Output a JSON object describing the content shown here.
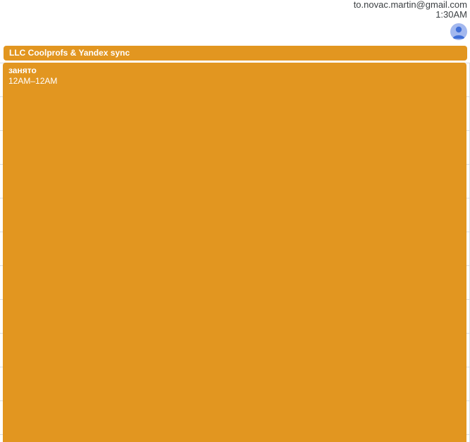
{
  "account": {
    "email": "to.novac.martin@gmail.com",
    "time": "1:30AM",
    "avatar_icon": "person-avatar-icon",
    "avatar_color": "#a3b8ee"
  },
  "allday_event": {
    "title": "LLC Coolprofs & Yandex sync",
    "color": "#e29620"
  },
  "timed_event": {
    "title": "занято",
    "time": "12AM–12AM",
    "color": "#e29620"
  }
}
